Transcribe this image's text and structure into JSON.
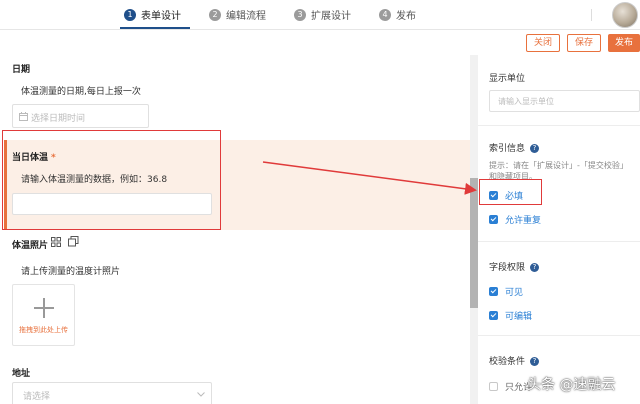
{
  "steps": [
    {
      "num": "1",
      "label": "表单设计",
      "active": true
    },
    {
      "num": "2",
      "label": "编辑流程",
      "active": false
    },
    {
      "num": "3",
      "label": "扩展设计",
      "active": false
    },
    {
      "num": "4",
      "label": "发布",
      "active": false
    }
  ],
  "toolbar": {
    "close_label": "关闭",
    "save_label": "保存",
    "publish_label": "发布"
  },
  "form": {
    "date_field": {
      "title": "日期",
      "desc": "体温测量的日期,每日上报一次",
      "placeholder": "选择日期时间"
    },
    "temp_field": {
      "title": "当日体温",
      "required_mark": "*",
      "desc": "请输入体温测量的数据，例如：36.8"
    },
    "photo_field": {
      "title": "体温照片",
      "desc": "请上传测量的温度计照片",
      "upload_text": "拖拽到此处上传"
    },
    "address_field": {
      "title": "地址",
      "placeholder": "请选择"
    }
  },
  "panel": {
    "unit": {
      "title": "显示单位",
      "placeholder": "请输入显示单位"
    },
    "index": {
      "title": "索引信息",
      "hint_line1": "提示：请在「扩展设计」-「提交校验」",
      "hint_line2": "和隐藏项目。"
    },
    "required_label": "必填",
    "allow_duplicate_label": "允许重复",
    "permission": {
      "title": "字段权限",
      "visible_label": "可见",
      "editable_label": "可编辑"
    },
    "validation": {
      "title": "校验条件",
      "partial_option": "只允许"
    }
  },
  "watermark": "头条 @速融云",
  "colors": {
    "accent": "#e8713d",
    "primary": "#1f4f8a",
    "checkbox": "#2a7fd4",
    "annotation": "#e03a3a"
  }
}
